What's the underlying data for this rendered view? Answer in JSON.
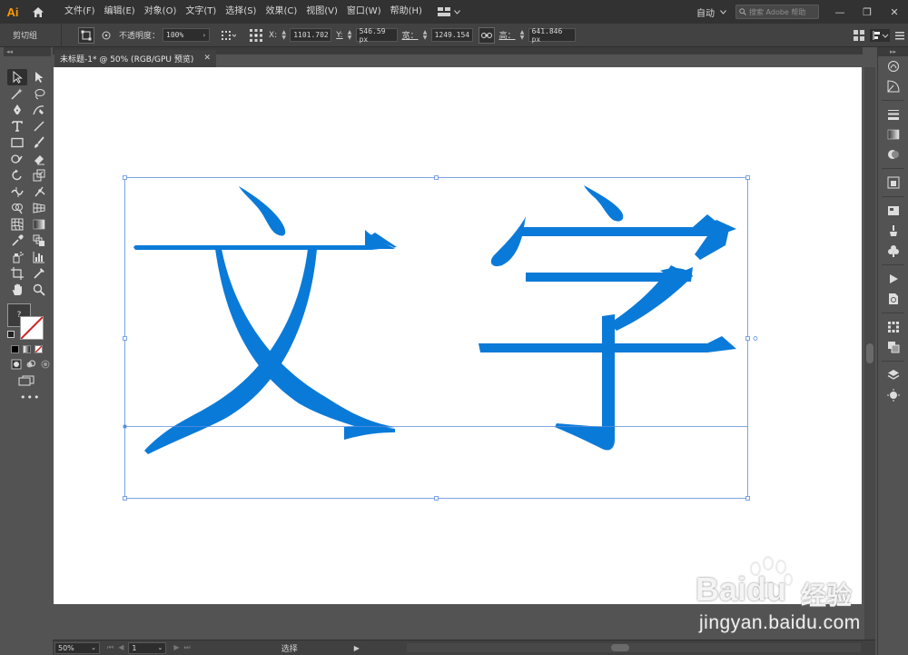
{
  "app": {
    "logo": "Ai",
    "menu": [
      "文件(F)",
      "编辑(E)",
      "对象(O)",
      "文字(T)",
      "选择(S)",
      "效果(C)",
      "视图(V)",
      "窗口(W)",
      "帮助(H)"
    ],
    "workspace_mode": "自动",
    "search_placeholder": "搜索 Adobe 帮助",
    "window_controls": [
      "—",
      "❐",
      "✕"
    ]
  },
  "control_bar": {
    "selection_label": "剪切组",
    "opacity_label": "不透明度：",
    "opacity_value": "100%",
    "x_label": "X:",
    "x_value": "1101.702",
    "y_label": "Y:",
    "y_value": "546.59 px",
    "w_label": "宽：",
    "w_value": "1249.154",
    "h_label": "高：",
    "h_value": "641.846 px"
  },
  "document": {
    "tab_title": "未标题-1* @ 50% (RGB/GPU 预览)",
    "tab_close": "✕",
    "artwork_text": [
      "文",
      "字"
    ],
    "text_color": "#0a7ad9",
    "selection_color": "#5a8edc"
  },
  "status_bar": {
    "zoom": "50%",
    "page": "1",
    "tool": "选择"
  },
  "tools": [
    "selection-tool-icon",
    "direct-selection-tool-icon",
    "magic-wand-tool-icon",
    "lasso-tool-icon",
    "pen-tool-icon",
    "curvature-tool-icon",
    "type-tool-icon",
    "line-segment-tool-icon",
    "rectangle-tool-icon",
    "paintbrush-tool-icon",
    "shaper-tool-icon",
    "eraser-tool-icon",
    "rotate-tool-icon",
    "scale-tool-icon",
    "width-tool-icon",
    "puppet-warp-tool-icon",
    "shape-builder-tool-icon",
    "perspective-grid-tool-icon",
    "mesh-tool-icon",
    "gradient-tool-icon",
    "eyedropper-tool-icon",
    "blend-tool-icon",
    "symbol-sprayer-tool-icon",
    "column-graph-tool-icon",
    "artboard-tool-icon",
    "slice-tool-icon",
    "hand-tool-icon",
    "zoom-tool-icon"
  ],
  "watermark": {
    "brand": "Baidu",
    "brand_cn": "经验",
    "url": "jingyan.baidu.com"
  }
}
